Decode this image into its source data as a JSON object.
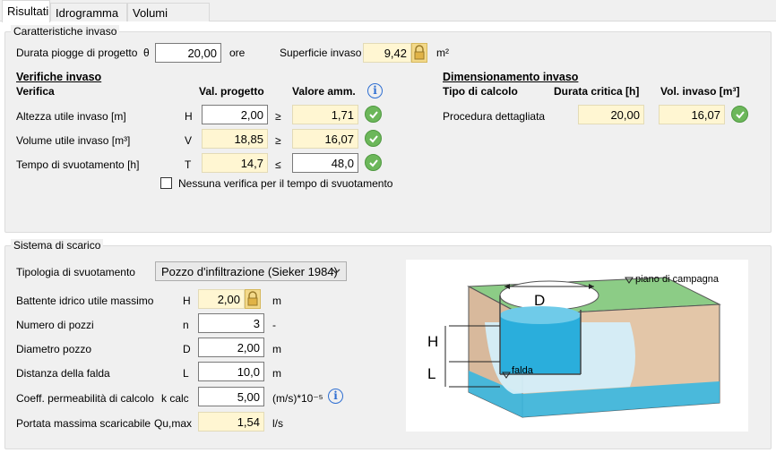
{
  "tabs": [
    "Risultati",
    "Idrogramma",
    "Volumi invaso"
  ],
  "caratteristiche": {
    "legend": "Caratteristiche invaso",
    "durata_label": "Durata piogge di progetto",
    "durata_symbol": "θ",
    "durata_value": "20,00",
    "durata_unit": "ore",
    "superficie_label": "Superficie invaso",
    "superficie_value": "9,42",
    "superficie_unit": "m²"
  },
  "verifiche": {
    "title": "Verifiche invaso",
    "col_verifica": "Verifica",
    "col_val_progetto": "Val. progetto",
    "col_valore_amm": "Valore amm.",
    "rows": [
      {
        "label": "Altezza utile invaso [m]",
        "symbol": "H",
        "value": "2,00",
        "op": "≥",
        "amm": "1,71"
      },
      {
        "label": "Volume utile invaso [m³]",
        "symbol": "V",
        "value": "18,85",
        "op": "≥",
        "amm": "16,07"
      },
      {
        "label": "Tempo di svuotamento [h]",
        "symbol": "T",
        "value": "14,7",
        "op": "≤",
        "amm": "48,0"
      }
    ],
    "checkbox_label": "Nessuna verifica per il tempo di svuotamento",
    "checkbox_checked": false
  },
  "dimensionamento": {
    "title": "Dimensionamento invaso",
    "col_tipo": "Tipo di calcolo",
    "col_durata": "Durata critica [h]",
    "col_vol": "Vol. invaso [m³]",
    "tipo": "Procedura dettagliata",
    "durata": "20,00",
    "vol": "16,07"
  },
  "sistema": {
    "legend": "Sistema di scarico",
    "tipologia_label": "Tipologia di svuotamento",
    "tipologia_value": "Pozzo d'infiltrazione (Sieker 1984)",
    "rows": [
      {
        "label": "Battente idrico utile massimo",
        "symbol": "H",
        "value": "2,00",
        "unit": "m"
      },
      {
        "label": "Numero di pozzi",
        "symbol": "n",
        "value": "3",
        "unit": "-"
      },
      {
        "label": "Diametro pozzo",
        "symbol": "D",
        "value": "2,00",
        "unit": "m"
      },
      {
        "label": "Distanza della falda",
        "symbol": "L",
        "value": "10,0",
        "unit": "m"
      },
      {
        "label": "Coeff. permeabilità di calcolo",
        "symbol": "k calc",
        "value": "5,00",
        "unit": "(m/s)*10⁻⁵"
      },
      {
        "label": "Portata massima scaricabile",
        "symbol": "Qu,max",
        "value": "1,54",
        "unit": "l/s"
      }
    ]
  },
  "diagram": {
    "piano": "piano di campagna",
    "d": "D",
    "h": "H",
    "l": "L",
    "falda": "falda"
  },
  "colors": {
    "ok": "#6cb75a",
    "readonly": "#fff6d2",
    "info": "#2f6fd2",
    "water": "#38b7e0"
  }
}
